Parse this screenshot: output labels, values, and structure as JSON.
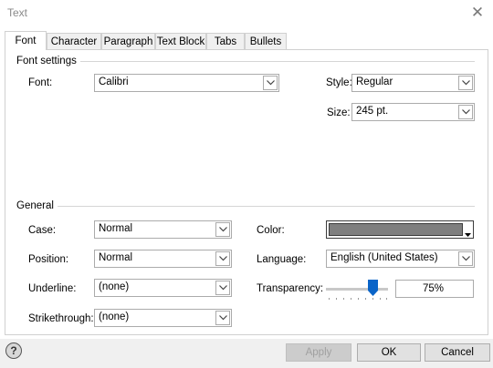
{
  "window": {
    "title": "Text"
  },
  "tabs": [
    "Font",
    "Character",
    "Paragraph",
    "Text Block",
    "Tabs",
    "Bullets"
  ],
  "font_settings": {
    "section_title": "Font settings",
    "font_label": "Font:",
    "font_value": "Calibri",
    "style_label": "Style:",
    "style_value": "Regular",
    "size_label": "Size:",
    "size_value": "245 pt."
  },
  "general": {
    "section_title": "General",
    "case_label": "Case:",
    "case_value": "Normal",
    "position_label": "Position:",
    "position_value": "Normal",
    "underline_label": "Underline:",
    "underline_value": "(none)",
    "strikethrough_label": "Strikethrough:",
    "strikethrough_value": "(none)",
    "color_label": "Color:",
    "color_value": "#7f7f7f",
    "language_label": "Language:",
    "language_value": "English (United States)",
    "transparency_label": "Transparency:",
    "transparency_value": "75%",
    "transparency_level": 75
  },
  "buttons": {
    "apply": "Apply",
    "ok": "OK",
    "cancel": "Cancel"
  },
  "icons": {
    "help": "help-icon",
    "close": "close-icon"
  }
}
